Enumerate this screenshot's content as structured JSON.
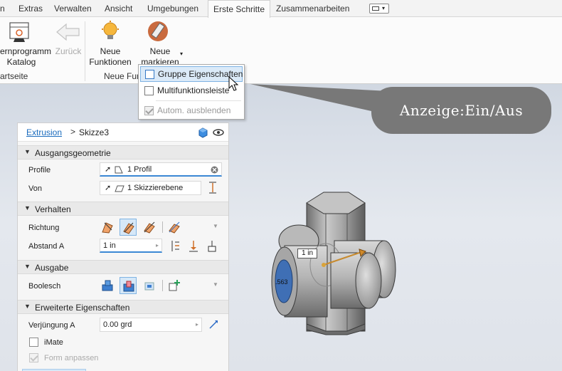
{
  "tabs": [
    {
      "label": "n",
      "active": false
    },
    {
      "label": "Extras",
      "active": false
    },
    {
      "label": "Verwalten",
      "active": false
    },
    {
      "label": "Ansicht",
      "active": false
    },
    {
      "label": "Umgebungen",
      "active": false
    },
    {
      "label": "Erste Schritte",
      "active": true
    },
    {
      "label": "Zusammenarbeiten",
      "active": false
    }
  ],
  "ribbon": {
    "catalog_line1": "ernprogramm",
    "catalog_line2": "Katalog",
    "back_label": "Zurück",
    "group1_label": "artseite",
    "new_features_line1": "Neue",
    "new_features_line2": "Funktionen",
    "mark_new_line1": "Neue",
    "mark_new_line2": "markieren",
    "group2_label": "Neue Fun"
  },
  "dropdown": {
    "items": [
      {
        "label": "Gruppe Eigenschaften",
        "checked": false
      },
      {
        "label": "Multifunktionsleiste",
        "checked": false
      },
      {
        "label": "Autom. ausblenden",
        "checked": true,
        "disabled": true
      }
    ]
  },
  "callout": {
    "text": "Anzeige:Ein/Aus"
  },
  "panel": {
    "breadcrumb_link": "Extrusion",
    "breadcrumb_sep": ">",
    "breadcrumb_current": "Skizze3",
    "sections": {
      "ausgangsgeometrie": "Ausgangsgeometrie",
      "verhalten": "Verhalten",
      "ausgabe": "Ausgabe",
      "erweitert": "Erweiterte Eigenschaften"
    },
    "profile_label": "Profile",
    "profile_value": "1 Profil",
    "von_label": "Von",
    "von_value": "1 Skizzierebene",
    "richtung_label": "Richtung",
    "abstand_label": "Abstand A",
    "abstand_value": "1 in",
    "boolesch_label": "Boolesch",
    "verjuengung_label": "Verjüngung A",
    "verjuengung_value": "0.00 grd",
    "imate_label": "iMate",
    "form_label": "Form anpassen"
  },
  "viewport": {
    "dimension_tag": "1 in",
    "hole_label": ".563"
  },
  "colors": {
    "accent": "#1a6bbd",
    "callout_bg": "#787878",
    "highlight": "#dbeaf8"
  }
}
